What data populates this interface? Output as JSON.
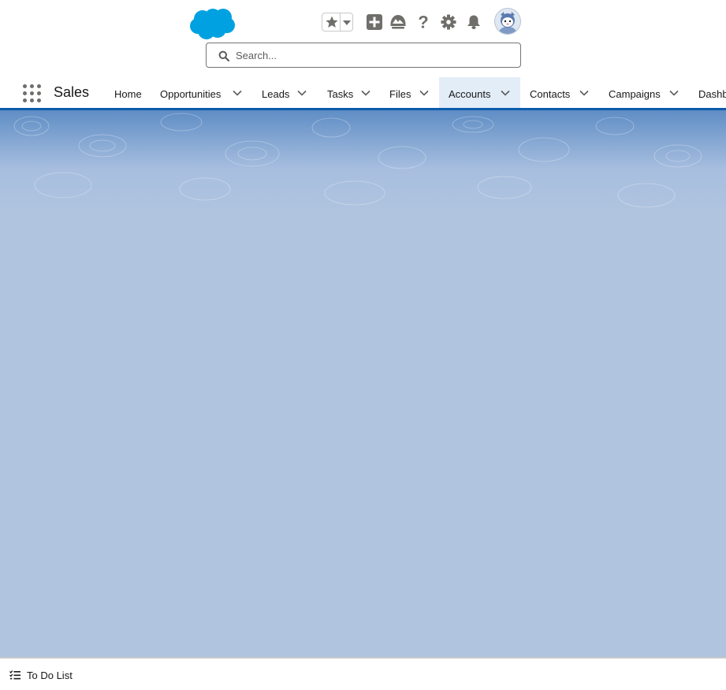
{
  "header": {
    "logo_name": "salesforce-cloud-logo",
    "brand_color": "#00a1e0",
    "search": {
      "placeholder": "Search...",
      "value": ""
    },
    "utility_icons": [
      "favorites-star-icon",
      "favorites-dropdown-icon",
      "global-actions-icon",
      "trailhead-icon",
      "help-icon",
      "setup-gear-icon",
      "notifications-bell-icon",
      "user-avatar"
    ]
  },
  "nav": {
    "app_name": "Sales",
    "items": [
      {
        "label": "Home",
        "has_menu": false
      },
      {
        "label": "Opportunities",
        "has_menu": true
      },
      {
        "label": "Leads",
        "has_menu": true
      },
      {
        "label": "Tasks",
        "has_menu": true
      },
      {
        "label": "Files",
        "has_menu": true
      },
      {
        "label": "Accounts",
        "has_menu": true,
        "active": true
      },
      {
        "label": "Contacts",
        "has_menu": true
      },
      {
        "label": "Campaigns",
        "has_menu": true
      },
      {
        "label": "Dashb",
        "has_menu": false
      }
    ],
    "accent_color": "#0b5cab"
  },
  "footer": {
    "todo_label": "To Do List"
  },
  "colors": {
    "page_background": "#b0c4df",
    "active_tab_background": "#e3edf8",
    "icon_gray": "#706e6b"
  }
}
